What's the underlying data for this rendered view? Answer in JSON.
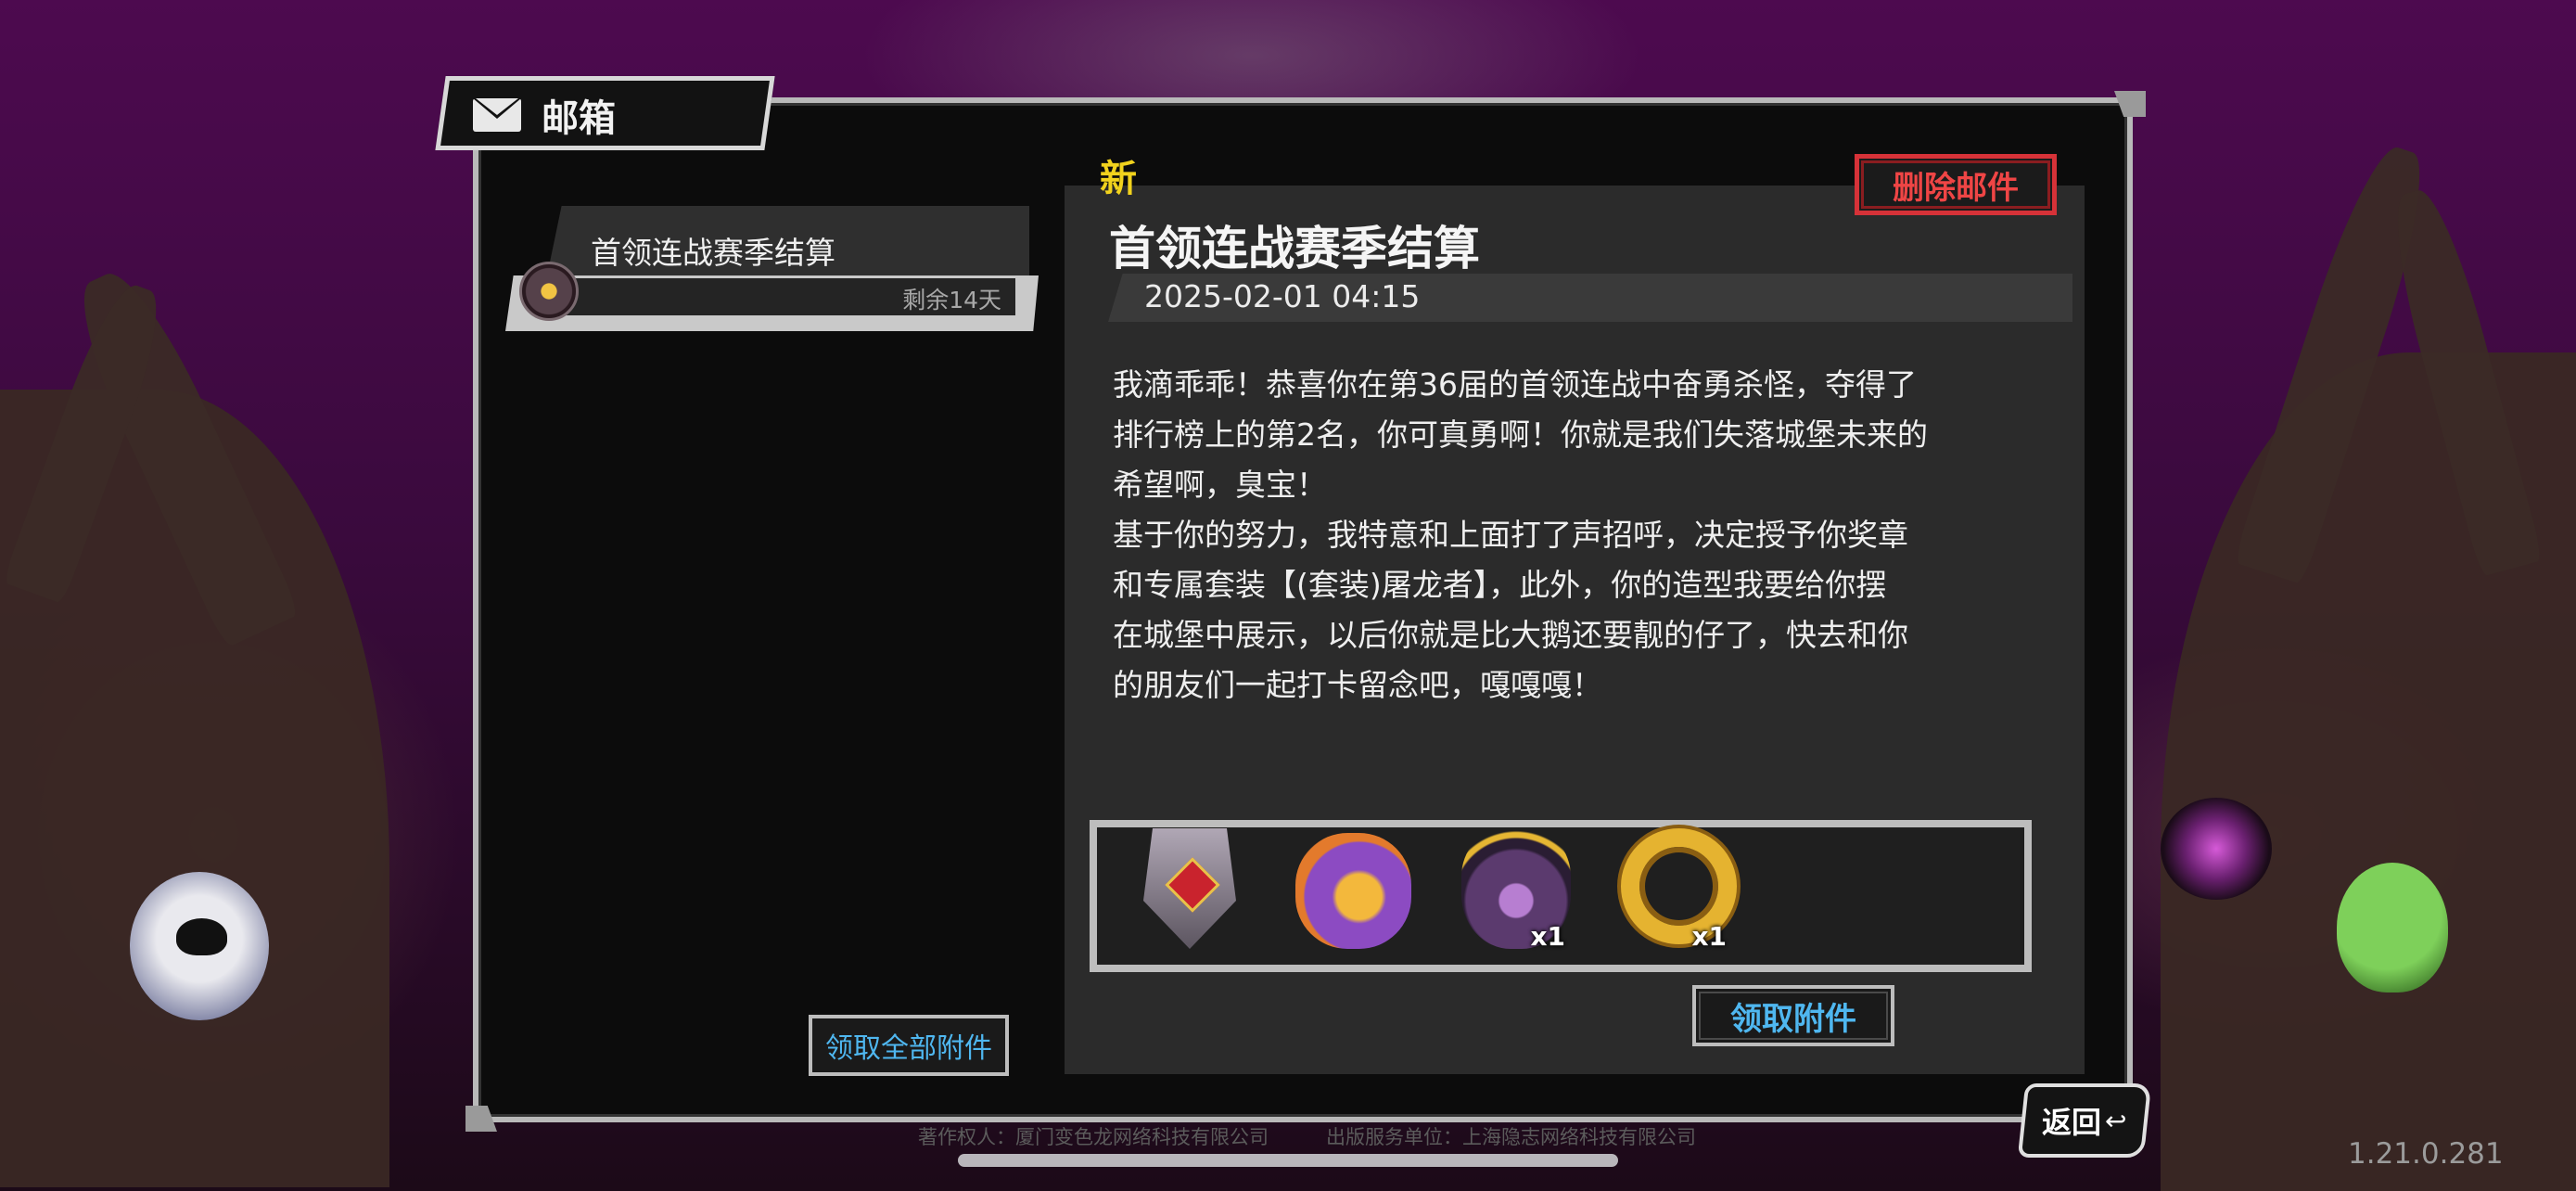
{
  "window": {
    "title": "邮箱"
  },
  "mail_list": {
    "items": [
      {
        "title": "首领连战赛季结算",
        "remaining": "剩余14天"
      }
    ],
    "claim_all_label": "领取全部附件"
  },
  "mail_detail": {
    "new_label": "新",
    "delete_label": "删除邮件",
    "subject": "首领连战赛季结算",
    "date": "2025-02-01 04:15",
    "body_lines": [
      "我滴乖乖！恭喜你在第36届的首领连战中奋勇杀怪，夺得了",
      "排行榜上的第2名，你可真勇啊！你就是我们失落城堡未来的",
      "希望啊，臭宝！",
      "基于你的努力，我特意和上面打了声招呼，决定授予你奖章",
      "和专属套装【(套装)屠龙者】，此外，你的造型我要给你摆",
      "在城堡中展示，以后你就是比大鹅还要靓的仔了，快去和你",
      "的朋友们一起打卡留念吧，嘎嘎嘎！"
    ],
    "attachments": [
      {
        "icon": "medal-icon",
        "count": ""
      },
      {
        "icon": "shoulder-armor-icon",
        "count": ""
      },
      {
        "icon": "dragon-helmet-icon",
        "count": "x1"
      },
      {
        "icon": "golden-dragon-ring-icon",
        "count": "x1"
      }
    ],
    "claim_label": "领取附件"
  },
  "footer": {
    "copyright_owner": "著作权人：厦门变色龙网络科技有限公司",
    "publisher": "出版服务单位：上海隐志网络科技有限公司",
    "back_label": "返回",
    "version": "1.21.0.281"
  },
  "colors": {
    "accent_blue": "#4fb7f0",
    "delete_red": "#ef4545",
    "new_yellow": "#f1d21d"
  }
}
